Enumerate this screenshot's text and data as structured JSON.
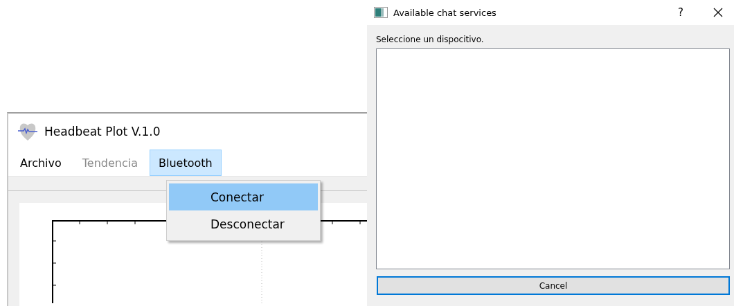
{
  "main_window": {
    "title": "Headbeat Plot V.1.0",
    "menu": [
      {
        "label": "Archivo",
        "disabled": false,
        "selected": false
      },
      {
        "label": "Tendencia",
        "disabled": true,
        "selected": false
      },
      {
        "label": "Bluetooth",
        "disabled": false,
        "selected": true
      }
    ],
    "dropdown": {
      "items": [
        {
          "label": "Conectar",
          "selected": true
        },
        {
          "label": "Desconectar",
          "selected": false
        }
      ]
    }
  },
  "dialog": {
    "title": "Available chat services",
    "help": "?",
    "prompt": "Seleccione un dispocitivo.",
    "button": {
      "label": "Cancel",
      "focused": true
    }
  }
}
